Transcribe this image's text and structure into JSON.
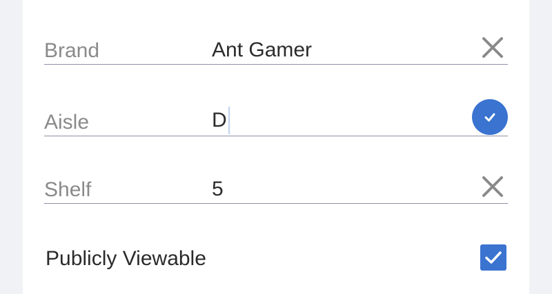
{
  "form": {
    "brand": {
      "label": "Brand",
      "value": "Ant Gamer",
      "action_icon": "close-icon"
    },
    "aisle": {
      "label": "Aisle",
      "value": "D",
      "action_icon": "check-circle-icon"
    },
    "shelf": {
      "label": "Shelf",
      "value": "5",
      "action_icon": "close-icon"
    },
    "public": {
      "label": "Publicly Viewable",
      "checked": true,
      "icon": "checkbox-checked-icon"
    }
  },
  "colors": {
    "accent": "#3a73d0",
    "label": "#8a8a8a",
    "underline": "#8e8fa6",
    "background": "#f1f2f5",
    "card": "#ffffff"
  }
}
